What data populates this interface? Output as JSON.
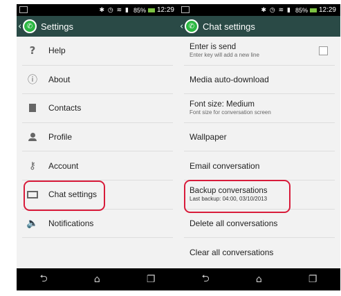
{
  "status": {
    "battery": "85%",
    "time": "12:29"
  },
  "settings_screen": {
    "title": "Settings",
    "items": [
      {
        "label": "Help",
        "icon": "help-icon"
      },
      {
        "label": "About",
        "icon": "info-icon"
      },
      {
        "label": "Contacts",
        "icon": "contacts-icon"
      },
      {
        "label": "Profile",
        "icon": "profile-icon"
      },
      {
        "label": "Account",
        "icon": "key-icon"
      },
      {
        "label": "Chat settings",
        "icon": "chat-settings-icon"
      },
      {
        "label": "Notifications",
        "icon": "speaker-icon"
      }
    ]
  },
  "chat_settings_screen": {
    "title": "Chat settings",
    "items": [
      {
        "label": "Enter is send",
        "sub": "Enter key will add a new line"
      },
      {
        "label": "Media auto-download"
      },
      {
        "label": "Font size: Medium",
        "sub": "Font size for conversation screen"
      },
      {
        "label": "Wallpaper"
      },
      {
        "label": "Email conversation"
      },
      {
        "label": "Backup conversations",
        "sub": "Last backup: 04:00, 03/10/2013"
      },
      {
        "label": "Delete all conversations"
      },
      {
        "label": "Clear all conversations"
      }
    ]
  },
  "colors": {
    "appbar": "#2a4a46",
    "highlight": "#d81b3a",
    "logo": "#2cb742"
  }
}
